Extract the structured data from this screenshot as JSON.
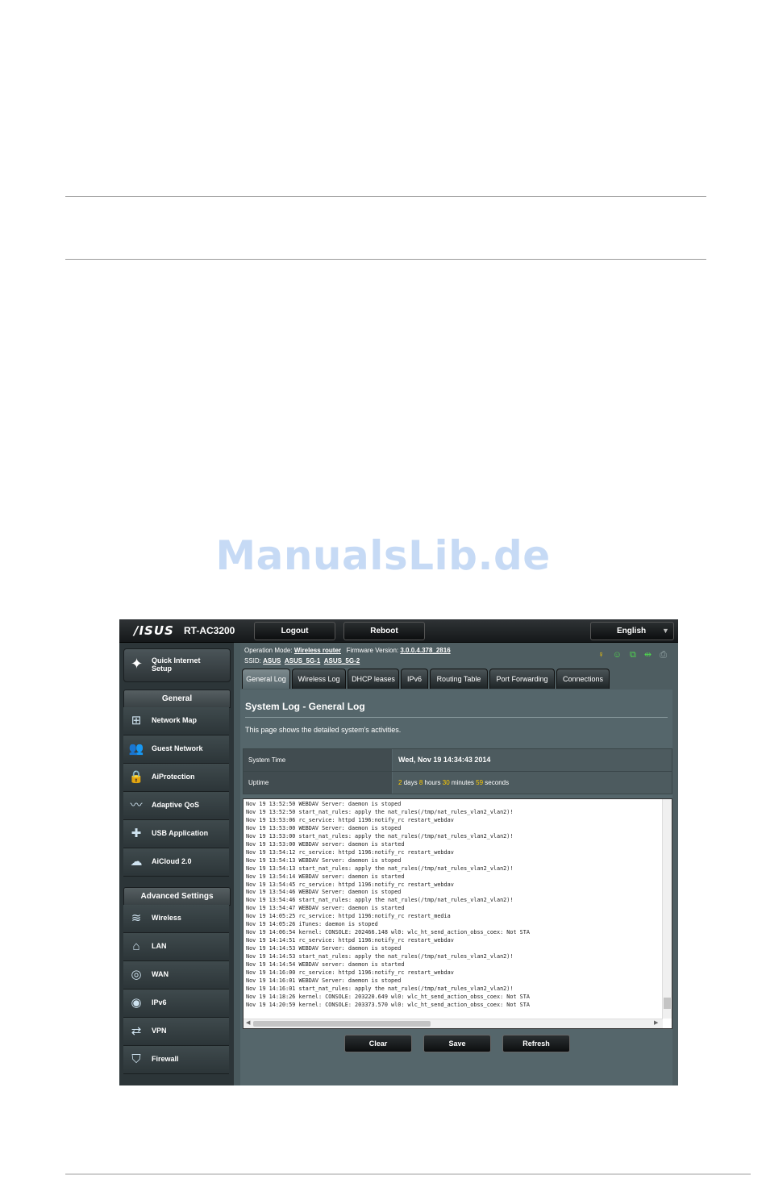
{
  "watermark": "ManualsLib.de",
  "router": {
    "brand": "/ISUS",
    "model": "RT-AC3200",
    "top_buttons": {
      "logout": "Logout",
      "reboot": "Reboot"
    },
    "language": "English",
    "info": {
      "op_mode_label": "Operation Mode:",
      "op_mode_value": "Wireless router",
      "fw_label": "Firmware Version:",
      "fw_value": "3.0.0.4.378_2816",
      "ssid_label": "SSID:",
      "ssid_1": "ASUS",
      "ssid_2": "ASUS_5G-1",
      "ssid_3": "ASUS_5G-2"
    },
    "status_icons": [
      "wifi-icon",
      "client-icon",
      "app-icon",
      "usb-icon",
      "printer-icon"
    ],
    "sidebar": {
      "qis": "Quick Internet\nSetup",
      "general_header": "General",
      "general_items": [
        "Network Map",
        "Guest Network",
        "AiProtection",
        "Adaptive QoS",
        "USB Application",
        "AiCloud 2.0"
      ],
      "advanced_header": "Advanced Settings",
      "advanced_items": [
        "Wireless",
        "LAN",
        "WAN",
        "IPv6",
        "VPN",
        "Firewall"
      ]
    },
    "tabs": [
      "General Log",
      "Wireless Log",
      "DHCP leases",
      "IPv6",
      "Routing Table",
      "Port Forwarding",
      "Connections"
    ],
    "panel": {
      "title": "System Log - General Log",
      "description": "This page shows the detailed system's activities.",
      "system_time_label": "System Time",
      "system_time_value": "Wed, Nov 19 14:34:43 2014",
      "uptime_label": "Uptime",
      "uptime": {
        "days": "2",
        "days_label": "days",
        "hours": "8",
        "hours_label": "hours",
        "minutes": "30",
        "minutes_label": "minutes",
        "seconds": "59",
        "seconds_label": "seconds"
      },
      "log": "Nov 19 13:52:50 WEBDAV Server: daemon is stoped\nNov 19 13:52:50 start_nat_rules: apply the nat_rules(/tmp/nat_rules_vlan2_vlan2)!\nNov 19 13:53:06 rc_service: httpd 1196:notify_rc restart_webdav\nNov 19 13:53:00 WEBDAV Server: daemon is stoped\nNov 19 13:53:00 start_nat_rules: apply the nat_rules(/tmp/nat_rules_vlan2_vlan2)!\nNov 19 13:53:00 WEBDAV server: daemon is started\nNov 19 13:54:12 rc_service: httpd 1196:notify_rc restart_webdav\nNov 19 13:54:13 WEBDAV Server: daemon is stoped\nNov 19 13:54:13 start_nat_rules: apply the nat_rules(/tmp/nat_rules_vlan2_vlan2)!\nNov 19 13:54:14 WEBDAV server: daemon is started\nNov 19 13:54:45 rc_service: httpd 1196:notify_rc restart_webdav\nNov 19 13:54:46 WEBDAV Server: daemon is stoped\nNov 19 13:54:46 start_nat_rules: apply the nat_rules(/tmp/nat_rules_vlan2_vlan2)!\nNov 19 13:54:47 WEBDAV server: daemon is started\nNov 19 14:05:25 rc_service: httpd 1196:notify_rc restart_media\nNov 19 14:05:26 iTunes: daemon is stoped\nNov 19 14:06:54 kernel: CONSOLE: 202466.148 wl0: wlc_ht_send_action_obss_coex: Not STA\nNov 19 14:14:51 rc_service: httpd 1196:notify_rc restart_webdav\nNov 19 14:14:53 WEBDAV Server: daemon is stoped\nNov 19 14:14:53 start_nat_rules: apply the nat_rules(/tmp/nat_rules_vlan2_vlan2)!\nNov 19 14:14:54 WEBDAV server: daemon is started\nNov 19 14:16:00 rc_service: httpd 1196:notify_rc restart_webdav\nNov 19 14:16:01 WEBDAV Server: daemon is stoped\nNov 19 14:16:01 start_nat_rules: apply the nat_rules(/tmp/nat_rules_vlan2_vlan2)!\nNov 19 14:18:26 kernel: CONSOLE: 203220.649 wl0: wlc_ht_send_action_obss_coex: Not STA\nNov 19 14:20:59 kernel: CONSOLE: 203373.570 wl0: wlc_ht_send_action_obss_coex: Not STA",
      "buttons": {
        "clear": "Clear",
        "save": "Save",
        "refresh": "Refresh"
      }
    }
  }
}
